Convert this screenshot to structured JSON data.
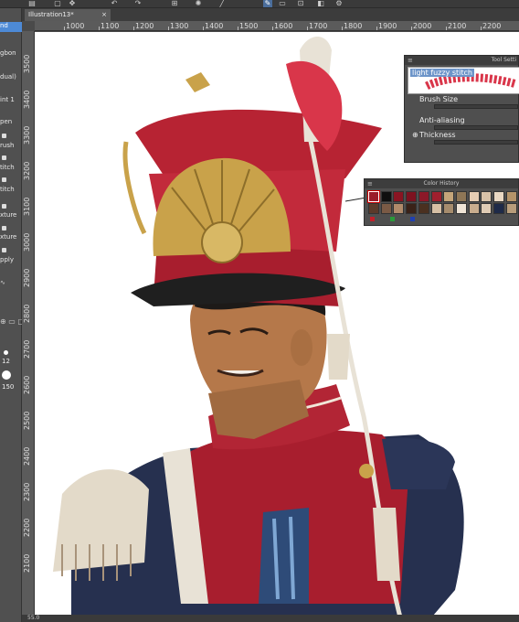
{
  "document": {
    "tab_title": "Illustration13*",
    "close_glyph": "×"
  },
  "left_panel": {
    "items": [
      {
        "label": "nd",
        "active": true
      },
      {
        "label": "gbon",
        "active": false
      },
      {
        "label": "dual)",
        "active": false
      },
      {
        "label": "int 1",
        "active": false
      },
      {
        "label": "pen",
        "active": false
      },
      {
        "label": "rush",
        "active": false
      },
      {
        "label": "titch",
        "active": false
      },
      {
        "label": "titch",
        "active": false
      },
      {
        "label": "xture",
        "active": false
      },
      {
        "label": "xture",
        "active": false
      },
      {
        "label": "pply",
        "active": false
      }
    ],
    "brush_size_value": "12",
    "opacity_value": "150"
  },
  "ruler_top": [
    "1000",
    "1100",
    "1200",
    "1300",
    "1400",
    "1500",
    "1600",
    "1700",
    "1800",
    "1900",
    "2000",
    "2100",
    "2200"
  ],
  "ruler_left": [
    "3500",
    "3400",
    "3300",
    "3200",
    "3100",
    "3000",
    "2900",
    "2800",
    "2700",
    "2600",
    "2500",
    "2400",
    "2300",
    "2200",
    "2100"
  ],
  "tool_settings": {
    "title": "Tool Setti",
    "brush_name": "light fuzzy stitch",
    "properties": [
      {
        "label": "Brush Size"
      },
      {
        "label": "Anti-aliasing"
      },
      {
        "label": "Thickness"
      }
    ],
    "stroke_color": "#d9364a"
  },
  "color_history": {
    "title": "Color History",
    "row1": [
      "#9b1c2a",
      "#0f0f0f",
      "#8a1422",
      "#7d1220",
      "#8c1828",
      "#a01f2e",
      "#c4a57a",
      "#8e7656",
      "#e6cdb3",
      "#d8c2a8",
      "#e9d8c3",
      "#b59469"
    ],
    "row2": [
      "#5a3a2a",
      "#7a5a45",
      "#b08a6a",
      "#3a2218",
      "#4a3020",
      "#d6bfa4",
      "#a68c6d",
      "#efe4d6",
      "#c9ad8e",
      "#e0ccb5",
      "#1e2a48",
      "#b89d7b"
    ],
    "marks": [
      "#c0202a",
      "#2a9a3a",
      "#2040b0"
    ]
  },
  "status_bar": {
    "zoom": "55.0"
  },
  "colors": {
    "accent": "#4d8ad6",
    "shako_red": "#a81e2e",
    "gold": "#c9a24a",
    "skin": "#b5784a",
    "navy": "#26304f"
  },
  "icons": [
    "menu-icon",
    "undo-icon",
    "redo-icon",
    "transform-icon",
    "spinner-icon",
    "pen-tool-icon",
    "plus-icon"
  ]
}
